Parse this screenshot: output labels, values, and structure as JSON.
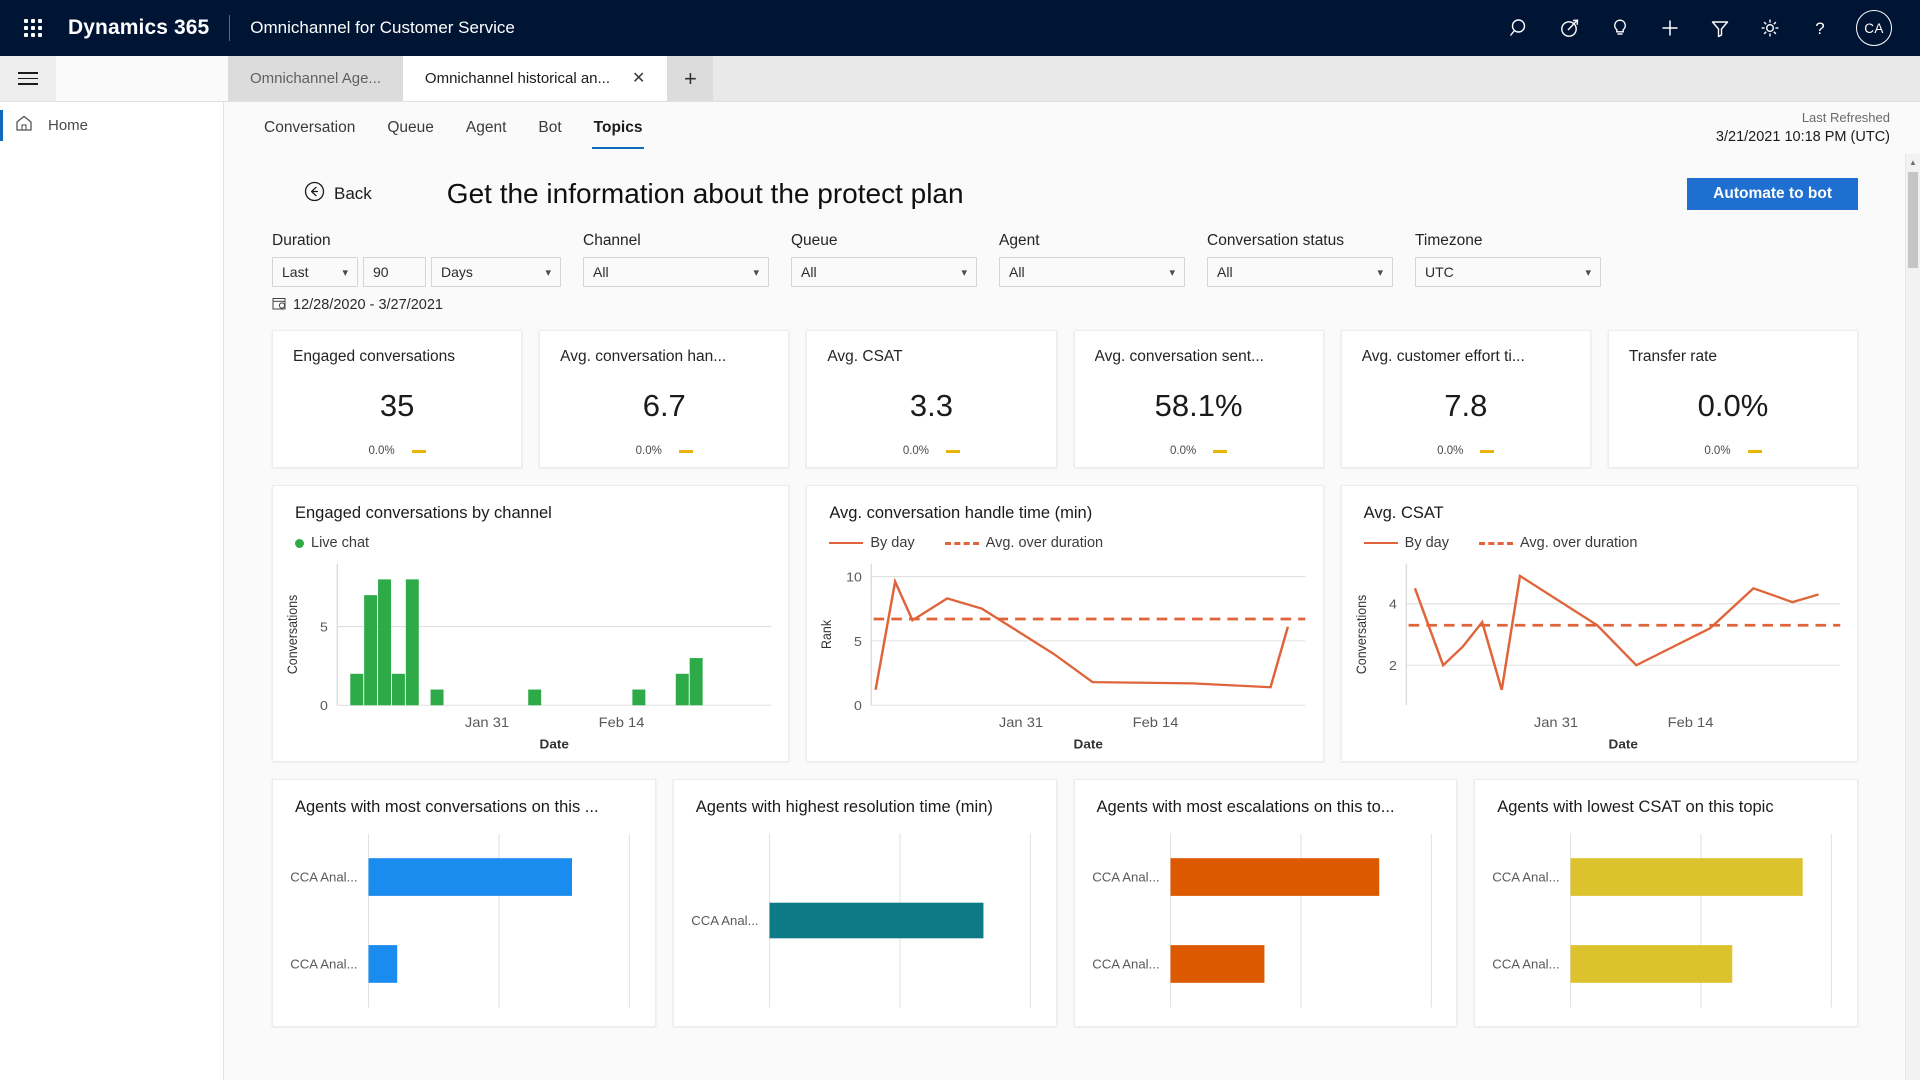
{
  "topnav": {
    "brand": "Dynamics 365",
    "app_name": "Omnichannel for Customer Service",
    "avatar_initials": "CA",
    "icons": [
      "search-icon",
      "target-icon",
      "lightbulb-icon",
      "plus-icon",
      "filter-icon",
      "gear-icon",
      "help-icon"
    ]
  },
  "tabstrip": {
    "tabs": [
      {
        "label": "Omnichannel Age...",
        "active": false
      },
      {
        "label": "Omnichannel historical an...",
        "active": true
      }
    ],
    "close_glyph": "✕",
    "add_glyph": "+"
  },
  "sidebar": {
    "items": [
      {
        "label": "Home",
        "icon": "home-icon",
        "active": true
      }
    ]
  },
  "analytics_tabs": [
    {
      "label": "Conversation",
      "active": false
    },
    {
      "label": "Queue",
      "active": false
    },
    {
      "label": "Agent",
      "active": false
    },
    {
      "label": "Bot",
      "active": false
    },
    {
      "label": "Topics",
      "active": true
    }
  ],
  "refresh": {
    "label": "Last Refreshed",
    "value": "3/21/2021 10:18 PM (UTC)"
  },
  "header": {
    "back_label": "Back",
    "page_title": "Get the information about the protect plan",
    "automate_label": "Automate to bot"
  },
  "filters": {
    "duration": {
      "label": "Duration",
      "mode": "Last",
      "amount": "90",
      "unit": "Days"
    },
    "channel": {
      "label": "Channel",
      "value": "All"
    },
    "queue": {
      "label": "Queue",
      "value": "All"
    },
    "agent": {
      "label": "Agent",
      "value": "All"
    },
    "conversation_status": {
      "label": "Conversation status",
      "value": "All"
    },
    "timezone": {
      "label": "Timezone",
      "value": "UTC"
    },
    "date_range": "12/28/2020 - 3/27/2021"
  },
  "kpis": [
    {
      "title": "Engaged conversations",
      "value": "35",
      "delta": "0.0%"
    },
    {
      "title": "Avg. conversation han...",
      "value": "6.7",
      "delta": "0.0%"
    },
    {
      "title": "Avg. CSAT",
      "value": "3.3",
      "delta": "0.0%"
    },
    {
      "title": "Avg. conversation sent...",
      "value": "58.1%",
      "delta": "0.0%"
    },
    {
      "title": "Avg. customer effort ti...",
      "value": "7.8",
      "delta": "0.0%"
    },
    {
      "title": "Transfer rate",
      "value": "0.0%",
      "delta": "0.0%"
    }
  ],
  "legends": {
    "live_chat": "Live chat",
    "by_day": "By day",
    "avg_over_duration": "Avg. over duration"
  },
  "colors": {
    "green": "#2eaa49",
    "orange_line": "#e0643a",
    "blue_bar": "#1a8cf0",
    "teal_bar": "#0e7a86",
    "orange_bar": "#dd5900",
    "yellow_bar": "#dcc32e",
    "accent": "#0f6cbd",
    "button_blue": "#1f6fd0",
    "flat_yellow": "#e8b406",
    "navy": "#001433"
  },
  "chart_data": [
    {
      "id": "engaged-conversations-by-channel",
      "type": "bar",
      "title": "Engaged conversations by channel",
      "xlabel": "Date",
      "ylabel": "Conversations",
      "ylim": [
        0,
        9
      ],
      "yticks": [
        0,
        5
      ],
      "xticks": [
        "Jan 31",
        "Feb 14"
      ],
      "xtick_positions": [
        0.345,
        0.655
      ],
      "grid": true,
      "legend_position": "top-left",
      "series": [
        {
          "name": "Live chat",
          "color": "#2eaa49",
          "x": [
            0.03,
            0.062,
            0.094,
            0.126,
            0.158,
            0.215,
            0.44,
            0.68,
            0.78,
            0.812
          ],
          "values": [
            2,
            7,
            8,
            2,
            8,
            1,
            1,
            1,
            2,
            3
          ]
        }
      ]
    },
    {
      "id": "avg-conversation-handle-time",
      "type": "line",
      "title": "Avg. conversation handle time (min)",
      "xlabel": "Date",
      "ylabel": "Rank",
      "ylim": [
        0,
        11
      ],
      "yticks": [
        0,
        5,
        10
      ],
      "xticks": [
        "Jan 31",
        "Feb 14"
      ],
      "xtick_positions": [
        0.345,
        0.655
      ],
      "grid": true,
      "legend_position": "top-left",
      "series": [
        {
          "name": "By day",
          "color": "#e0643a",
          "style": "solid",
          "x": [
            0.01,
            0.055,
            0.095,
            0.175,
            0.255,
            0.42,
            0.51,
            0.74,
            0.92,
            0.96
          ],
          "values": [
            1.2,
            9.6,
            6.6,
            8.3,
            7.5,
            4.0,
            1.8,
            1.7,
            1.4,
            6.1
          ]
        },
        {
          "name": "Avg. over duration",
          "color": "#e0643a",
          "style": "dashed",
          "constant": 6.7
        }
      ]
    },
    {
      "id": "avg-csat",
      "type": "line",
      "title": "Avg. CSAT",
      "xlabel": "Date",
      "ylabel": "Conversations",
      "ylim": [
        0.7,
        5.3
      ],
      "yticks": [
        2,
        4
      ],
      "xticks": [
        "Jan 31",
        "Feb 14"
      ],
      "xtick_positions": [
        0.345,
        0.655
      ],
      "grid": true,
      "legend_position": "top-left",
      "series": [
        {
          "name": "By day",
          "color": "#e0643a",
          "style": "solid",
          "x": [
            0.02,
            0.085,
            0.13,
            0.175,
            0.22,
            0.262,
            0.44,
            0.53,
            0.7,
            0.8,
            0.89,
            0.95
          ],
          "values": [
            4.5,
            2.0,
            2.6,
            3.4,
            1.2,
            4.9,
            3.3,
            2.0,
            3.2,
            4.5,
            4.05,
            4.3
          ]
        },
        {
          "name": "Avg. over duration",
          "color": "#e0643a",
          "style": "dashed",
          "constant": 3.3
        }
      ]
    },
    {
      "id": "agents-most-conversations",
      "type": "bar",
      "orientation": "horizontal",
      "title": "Agents with most conversations on this ...",
      "categories": [
        "CCA Anal...",
        "CCA Anal..."
      ],
      "values": [
        0.78,
        0.11
      ],
      "color": "#1a8cf0",
      "grid": true,
      "gridlines": [
        0.0,
        0.5,
        1.0
      ]
    },
    {
      "id": "agents-highest-resolution-time",
      "type": "bar",
      "orientation": "horizontal",
      "title": "Agents with highest resolution time (min)",
      "categories": [
        "CCA Anal..."
      ],
      "values": [
        0.82
      ],
      "color": "#0e7a86",
      "grid": true,
      "gridlines": [
        0.0,
        0.5,
        1.0
      ]
    },
    {
      "id": "agents-most-escalations",
      "type": "bar",
      "orientation": "horizontal",
      "title": "Agents with most escalations on this to...",
      "categories": [
        "CCA Anal...",
        "CCA Anal..."
      ],
      "values": [
        0.8,
        0.36
      ],
      "color": "#dd5900",
      "grid": true,
      "gridlines": [
        0.0,
        0.5,
        1.0
      ]
    },
    {
      "id": "agents-lowest-csat",
      "type": "bar",
      "orientation": "horizontal",
      "title": "Agents with lowest CSAT on this topic",
      "categories": [
        "CCA Anal...",
        "CCA Anal..."
      ],
      "values": [
        0.89,
        0.62
      ],
      "color": "#dcc32e",
      "grid": true,
      "gridlines": [
        0.0,
        0.5,
        1.0
      ]
    }
  ]
}
